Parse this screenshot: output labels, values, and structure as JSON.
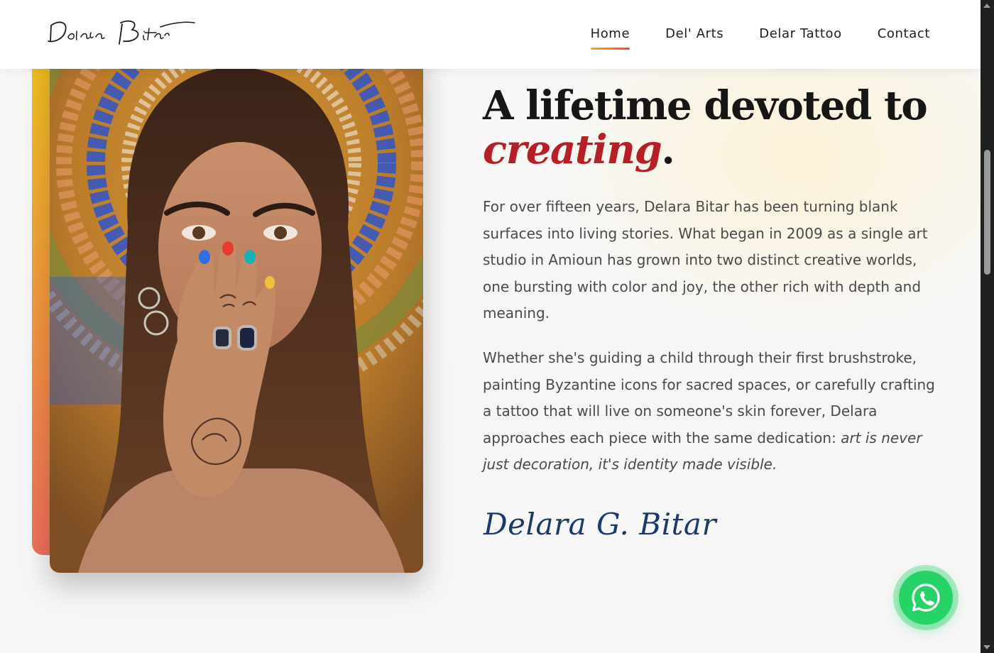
{
  "brand": {
    "name": "Delara Bitar"
  },
  "nav": {
    "items": [
      {
        "label": "Home",
        "active": true
      },
      {
        "label": "Del' Arts",
        "active": false
      },
      {
        "label": "Delar Tattoo",
        "active": false
      },
      {
        "label": "Contact",
        "active": false
      }
    ]
  },
  "about": {
    "headline_line1": "A lifetime devoted to",
    "headline_accent": "creating",
    "headline_end": ".",
    "paragraph1": "For over fifteen years, Delara Bitar has been turning blank surfaces into living stories. What began in 2009 as a single art studio in Amioun has grown into two distinct creative worlds, one bursting with color and joy, the other rich with depth and meaning.",
    "paragraph2": "Whether she's guiding a child through their first brushstroke, painting Byzantine icons for sacred spaces, or carefully crafting a tattoo that will live on someone's skin forever, Delara approaches each piece with the same dedication:",
    "paragraph2_emphasis": "art is never just decoration, it's identity made visible.",
    "signature": "Delara G. Bitar"
  },
  "colors": {
    "accent_red": "#b51f25",
    "signature_blue": "#1b3a6b",
    "whatsapp_green": "#25d366",
    "accent_gradient_start": "#f2c31f",
    "accent_gradient_end": "#f06f5c"
  },
  "icons": {
    "floating_button": "whatsapp-icon"
  }
}
